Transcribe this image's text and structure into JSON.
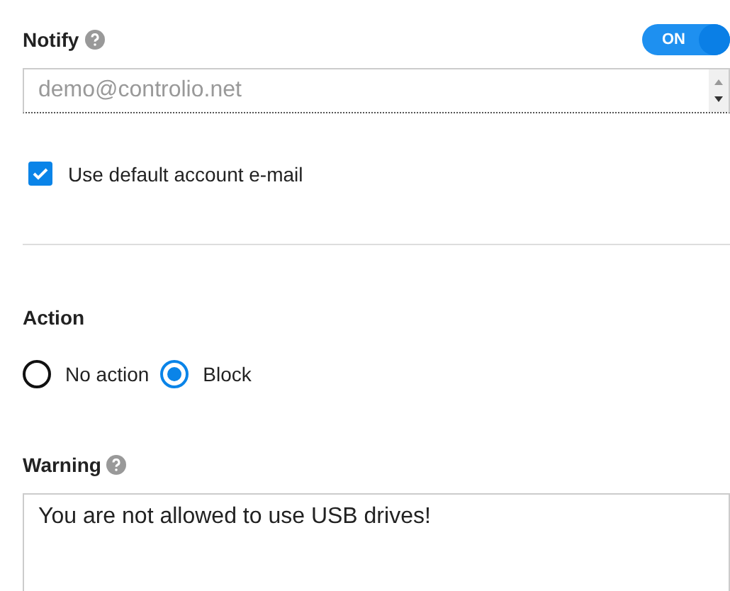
{
  "notify": {
    "label": "Notify",
    "toggle": {
      "label": "ON",
      "on": true
    },
    "email": {
      "placeholder": "demo@controlio.net"
    },
    "use_default": {
      "label": "Use default account e-mail",
      "checked": true
    }
  },
  "action": {
    "label": "Action",
    "options": [
      {
        "label": "No action",
        "selected": false
      },
      {
        "label": "Block",
        "selected": true
      }
    ]
  },
  "warning": {
    "label": "Warning",
    "value": "You are not allowed to use USB drives!"
  }
}
